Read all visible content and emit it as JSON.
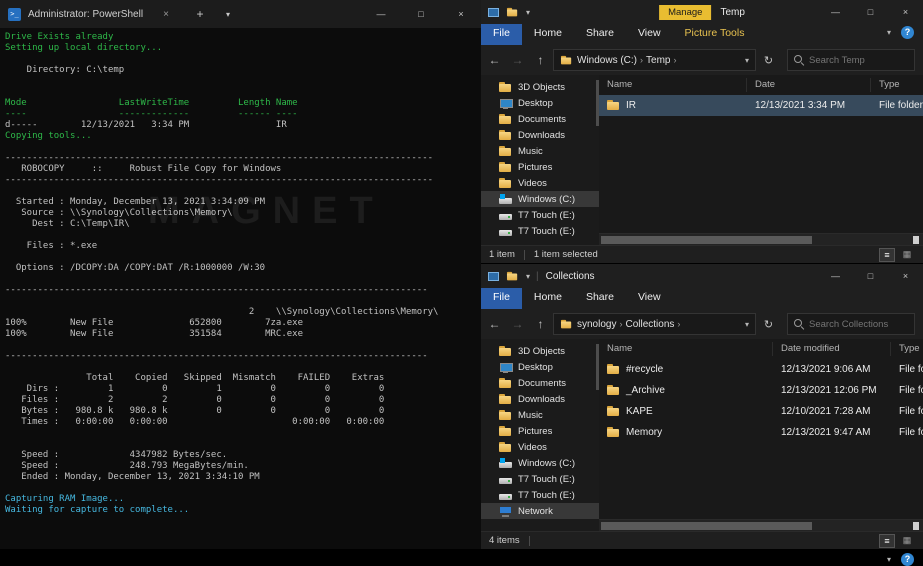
{
  "watermark": "MAGNET",
  "window_controls": {
    "minimize": "—",
    "maximize": "□",
    "close": "×"
  },
  "nav_icons": {
    "back": "←",
    "forward": "→",
    "up": "↑",
    "refresh": "↻",
    "dropdown": "▾",
    "sep": "›"
  },
  "ribbon_extras": {
    "chevron": "▾",
    "help": "?"
  },
  "view_icons": {
    "details": "≡",
    "thumbs": "▦"
  },
  "terminal": {
    "title": "Administrator: PowerShell",
    "icon_glyph": ">_",
    "tab_close": "×",
    "new_tab": "+",
    "tab_menu": "▾",
    "lines": [
      {
        "c": "green",
        "t": "Drive Exists already"
      },
      {
        "c": "green",
        "t": "Setting up local directory..."
      },
      {
        "c": "white",
        "t": ""
      },
      {
        "c": "white",
        "t": "    Directory: C:\\temp"
      },
      {
        "c": "white",
        "t": ""
      },
      {
        "c": "white",
        "t": ""
      },
      {
        "c": "green",
        "t": "Mode                 LastWriteTime         Length Name"
      },
      {
        "c": "green",
        "t": "----                 -------------         ------ ----"
      },
      {
        "c": "white",
        "t": "d-----        12/13/2021   3:34 PM                IR"
      },
      {
        "c": "green",
        "t": "Copying tools..."
      },
      {
        "c": "white",
        "t": ""
      },
      {
        "c": "white",
        "t": "-------------------------------------------------------------------------------"
      },
      {
        "c": "white",
        "t": "   ROBOCOPY     ::     Robust File Copy for Windows"
      },
      {
        "c": "white",
        "t": "-------------------------------------------------------------------------------"
      },
      {
        "c": "white",
        "t": ""
      },
      {
        "c": "white",
        "t": "  Started : Monday, December 13, 2021 3:34:09 PM"
      },
      {
        "c": "white",
        "t": "   Source : \\\\Synology\\Collections\\Memory\\"
      },
      {
        "c": "white",
        "t": "     Dest : C:\\Temp\\IR\\"
      },
      {
        "c": "white",
        "t": ""
      },
      {
        "c": "white",
        "t": "    Files : *.exe"
      },
      {
        "c": "white",
        "t": ""
      },
      {
        "c": "white",
        "t": "  Options : /DCOPY:DA /COPY:DAT /R:1000000 /W:30"
      },
      {
        "c": "white",
        "t": ""
      },
      {
        "c": "white",
        "t": "------------------------------------------------------------------------------"
      },
      {
        "c": "white",
        "t": ""
      },
      {
        "c": "white",
        "t": "                                             2    \\\\Synology\\Collections\\Memory\\"
      },
      {
        "c": "white",
        "t": "100%        New File              652800        7za.exe"
      },
      {
        "c": "white",
        "t": "100%        New File              351584        MRC.exe"
      },
      {
        "c": "white",
        "t": ""
      },
      {
        "c": "white",
        "t": "------------------------------------------------------------------------------"
      },
      {
        "c": "white",
        "t": ""
      },
      {
        "c": "white",
        "t": "               Total    Copied   Skipped  Mismatch    FAILED    Extras"
      },
      {
        "c": "white",
        "t": "    Dirs :         1         0         1         0         0         0"
      },
      {
        "c": "white",
        "t": "   Files :         2         2         0         0         0         0"
      },
      {
        "c": "white",
        "t": "   Bytes :   980.8 k   980.8 k         0         0         0         0"
      },
      {
        "c": "white",
        "t": "   Times :   0:00:00   0:00:00                       0:00:00   0:00:00"
      },
      {
        "c": "white",
        "t": ""
      },
      {
        "c": "white",
        "t": ""
      },
      {
        "c": "white",
        "t": "   Speed :             4347982 Bytes/sec."
      },
      {
        "c": "white",
        "t": "   Speed :             248.793 MegaBytes/min."
      },
      {
        "c": "white",
        "t": "   Ended : Monday, December 13, 2021 3:34:10 PM"
      },
      {
        "c": "white",
        "t": ""
      },
      {
        "c": "cyan",
        "t": "Capturing RAM Image..."
      },
      {
        "c": "cyan",
        "t": "Waiting for capture to complete..."
      }
    ]
  },
  "explorer_top": {
    "manage_label": "Manage",
    "title": "Temp",
    "tabs": [
      {
        "label": "File",
        "style": "file"
      },
      {
        "label": "Home",
        "style": "plain"
      },
      {
        "label": "Share",
        "style": "plain"
      },
      {
        "label": "View",
        "style": "plain"
      },
      {
        "label": "Picture Tools",
        "style": "contextual"
      }
    ],
    "breadcrumbs": [
      "Windows (C:)",
      "Temp"
    ],
    "search_placeholder": "Search Temp",
    "sidebar": [
      {
        "label": "3D Objects",
        "icon": "folder"
      },
      {
        "label": "Desktop",
        "icon": "monitor"
      },
      {
        "label": "Documents",
        "icon": "folder"
      },
      {
        "label": "Downloads",
        "icon": "folder"
      },
      {
        "label": "Music",
        "icon": "folder"
      },
      {
        "label": "Pictures",
        "icon": "folder"
      },
      {
        "label": "Videos",
        "icon": "folder"
      },
      {
        "label": "Windows (C:)",
        "icon": "drive-win",
        "state": "selected"
      },
      {
        "label": "T7 Touch (E:)",
        "icon": "drive"
      },
      {
        "label": "T7 Touch (E:)",
        "icon": "drive"
      }
    ],
    "columns": [
      "Name",
      "Date",
      "Type"
    ],
    "rows": [
      {
        "icon": "folder",
        "name": "IR",
        "date": "12/13/2021 3:34 PM",
        "type": "File folder",
        "state": "selected"
      }
    ],
    "status": {
      "count": "1 item",
      "selected": "1 item selected"
    }
  },
  "explorer_bottom": {
    "title": "Collections",
    "tabs": [
      {
        "label": "File",
        "style": "file"
      },
      {
        "label": "Home",
        "style": "plain"
      },
      {
        "label": "Share",
        "style": "plain"
      },
      {
        "label": "View",
        "style": "plain"
      }
    ],
    "breadcrumbs": [
      "synology",
      "Collections"
    ],
    "search_placeholder": "Search Collections",
    "sidebar": [
      {
        "label": "3D Objects",
        "icon": "folder"
      },
      {
        "label": "Desktop",
        "icon": "monitor"
      },
      {
        "label": "Documents",
        "icon": "folder"
      },
      {
        "label": "Downloads",
        "icon": "folder"
      },
      {
        "label": "Music",
        "icon": "folder"
      },
      {
        "label": "Pictures",
        "icon": "folder"
      },
      {
        "label": "Videos",
        "icon": "folder"
      },
      {
        "label": "Windows (C:)",
        "icon": "drive-win"
      },
      {
        "label": "T7 Touch (E:)",
        "icon": "drive"
      },
      {
        "label": "T7 Touch (E:)",
        "icon": "drive"
      },
      {
        "label": "Network",
        "icon": "network",
        "state": "selected"
      }
    ],
    "columns": [
      "Name",
      "Date modified",
      "Type"
    ],
    "rows": [
      {
        "icon": "folder",
        "name": "#recycle",
        "date": "12/13/2021 9:06 AM",
        "type": "File folder"
      },
      {
        "icon": "folder",
        "name": "_Archive",
        "date": "12/13/2021 12:06 PM",
        "type": "File folder"
      },
      {
        "icon": "folder",
        "name": "KAPE",
        "date": "12/10/2021 7:28 AM",
        "type": "File folder"
      },
      {
        "icon": "folder",
        "name": "Memory",
        "date": "12/13/2021 9:47 AM",
        "type": "File folder"
      }
    ],
    "status": {
      "count": "4 items",
      "selected": ""
    }
  }
}
